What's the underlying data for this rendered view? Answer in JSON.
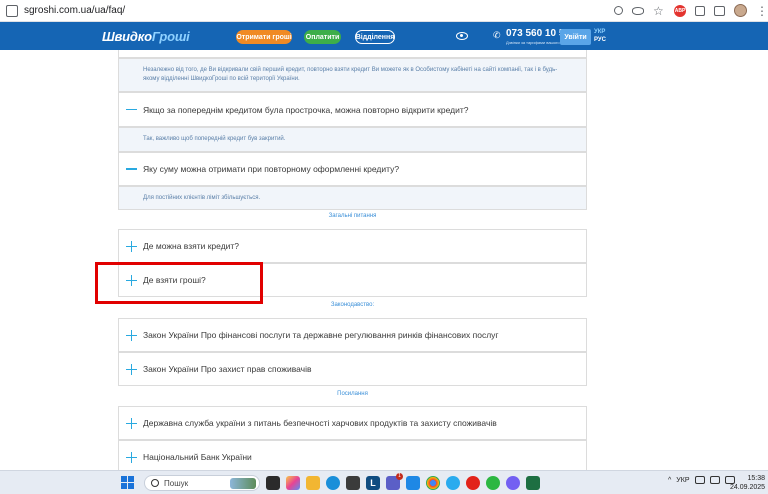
{
  "browser": {
    "url": "sgroshi.com.ua/ua/faq/"
  },
  "header": {
    "logo_part1": "Швидко",
    "logo_part2": "Гроші",
    "btn_get_money": "Отримати гроші",
    "btn_pay": "Оплатити",
    "btn_branches": "Відділення",
    "phone": "073 560 10 50",
    "phone_sub": "Дзвінки за тарифами вашого оператора",
    "login": "Увійти",
    "lang_ua": "УКР",
    "lang_ru": "РУС"
  },
  "faq": {
    "answer_top": "Незалежно від того, де Ви відкривали свій перший кредит, повторно взяти кредит Ви можете як в Особистому кабінеті на сайті компанії, так і в будь-якому відділенні ШвидкоГроші по всій території України.",
    "q_overdue": "Якщо за попереднім кредитом була прострочка, можна повторно відкрити кредит?",
    "a_overdue": "Так, важливо щоб попередній кредит був закритий.",
    "q_amount": "Яку суму можна отримати при повторному оформленні кредиту?",
    "a_amount": "Для постійних клієнтів ліміт збільшується.",
    "section_general": "Загальні питання",
    "q_where_credit": "Де можна взяти кредит?",
    "q_where_money": "Де взяти гроші?",
    "section_law": "Законодавство:",
    "q_law_fin": "Закон України Про фінансові послуги та державне регулювання ринків фінансових послуг",
    "q_law_consumer": "Закон України Про захист прав споживачів",
    "section_links": "Посилання",
    "q_food_service": "Державна служба україни з питань безпечності харчових продуктів та захисту споживачів",
    "q_nbu": "Національний Банк України"
  },
  "taskbar": {
    "search_placeholder": "Пошук",
    "lang": "УКР",
    "time": "15:38",
    "date": "24.09.2025",
    "badge": "1"
  }
}
